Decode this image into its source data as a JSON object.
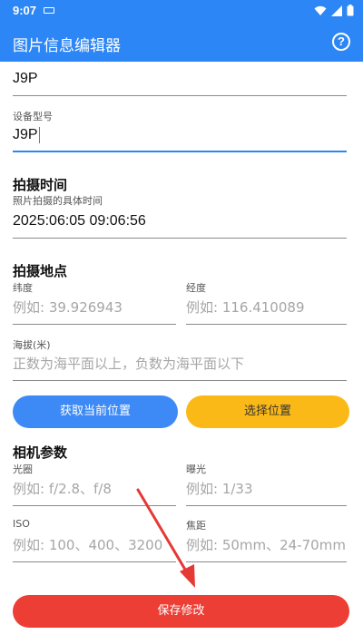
{
  "status_bar": {
    "time": "9:07"
  },
  "app_bar": {
    "title": "图片信息编辑器",
    "help": "?"
  },
  "device": {
    "model_value": "J9P",
    "device_model_label": "设备型号",
    "device_model_value": "J9P"
  },
  "shoot_time": {
    "title": "拍摄时间",
    "subtitle": "照片拍摄的具体时间",
    "value": "2025:06:05 09:06:56"
  },
  "location": {
    "title": "拍摄地点",
    "latitude_label": "纬度",
    "latitude_placeholder": "例如: 39.926943",
    "longitude_label": "经度",
    "longitude_placeholder": "例如: 116.410089",
    "altitude_label": "海拔(米)",
    "altitude_placeholder": "正数为海平面以上，负数为海平面以下",
    "get_location_button": "获取当前位置",
    "pick_location_button": "选择位置"
  },
  "camera": {
    "title": "相机参数",
    "aperture_label": "光圈",
    "aperture_placeholder": "例如: f/2.8、f/8",
    "exposure_label": "曝光",
    "exposure_placeholder": "例如: 1/33",
    "iso_label": "ISO",
    "iso_placeholder": "例如: 100、400、3200",
    "focal_label": "焦距",
    "focal_placeholder": "例如: 50mm、24-70mm"
  },
  "save_button": "保存修改",
  "colors": {
    "primary": "#2d86f5",
    "location_button": "#3d8af7",
    "pick_button": "#fbb917",
    "save_button": "#ec3e35",
    "annotation_arrow": "#e53935"
  }
}
